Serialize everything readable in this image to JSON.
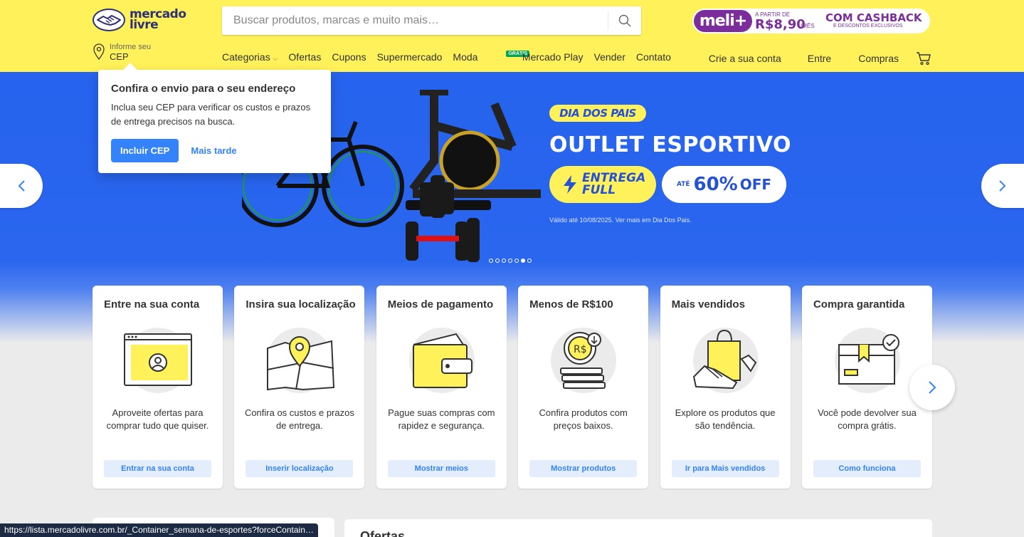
{
  "header": {
    "logo_line1": "mercado",
    "logo_line2": "livre",
    "search_placeholder": "Buscar produtos, marcas e muito mais…",
    "meli": {
      "badge": "meli+",
      "small": "A PARTIR DE",
      "price": "R$8,90",
      "per": "/MÊS",
      "cashback": "COM CASHBACK",
      "desc": "E DESCONTOS EXCLUSIVOS"
    },
    "cep_small": "Informe seu",
    "cep_big": "CEP",
    "nav": [
      "Categorias",
      "Ofertas",
      "Cupons",
      "Supermercado",
      "Moda",
      "Mercado Play",
      "Vender",
      "Contato"
    ],
    "gratis": "GRÁTIS",
    "user_nav": [
      "Crie a sua conta",
      "Entre",
      "Compras"
    ]
  },
  "popup": {
    "title": "Confira o envio para o seu endereço",
    "text": "Inclua seu CEP para verificar os custos e prazos de entrega precisos na busca.",
    "primary": "Incluir CEP",
    "secondary": "Mais tarde"
  },
  "hero": {
    "tag": "DIA DOS PAIS",
    "title": "OUTLET ESPORTIVO",
    "full_1": "ENTREGA",
    "full_2": "FULL",
    "ate": "ATÉ",
    "discount": "60%",
    "off": "OFF",
    "valid": "Válido até 10/08/2025. Ver mais em Dia Dos Pais.",
    "slides": 7,
    "active_slide": 6
  },
  "cards": [
    {
      "title": "Entre na sua conta",
      "desc": "Aproveite ofertas para comprar tudo que quiser.",
      "button": "Entrar na sua conta",
      "icon": "account-icon"
    },
    {
      "title": "Insira sua localização",
      "desc": "Confira os custos e prazos de entrega.",
      "button": "Inserir localização",
      "icon": "map-pin-icon"
    },
    {
      "title": "Meios de pagamento",
      "desc": "Pague suas compras com rapidez e segurança.",
      "button": "Mostrar meios",
      "icon": "wallet-icon"
    },
    {
      "title": "Menos de R$100",
      "desc": "Confira produtos com preços baixos.",
      "button": "Mostrar produtos",
      "icon": "coins-icon"
    },
    {
      "title": "Mais vendidos",
      "desc": "Explore os produtos que são tendência.",
      "button": "Ir para Mais vendidos",
      "icon": "shopping-bag-icon"
    },
    {
      "title": "Compra garantida",
      "desc": "Você pode devolver sua compra grátis.",
      "button": "Como funciona",
      "icon": "box-check-icon"
    }
  ],
  "bottom_title": "Ofertas",
  "status_url": "https://lista.mercadolivre.com.br/_Container_semana-de-esportes?forceContain…",
  "colors": {
    "header": "#fff159",
    "brand_blue": "#3483fa",
    "hero_blue": "#2663ee",
    "meli_purple": "#7b2d9c"
  }
}
